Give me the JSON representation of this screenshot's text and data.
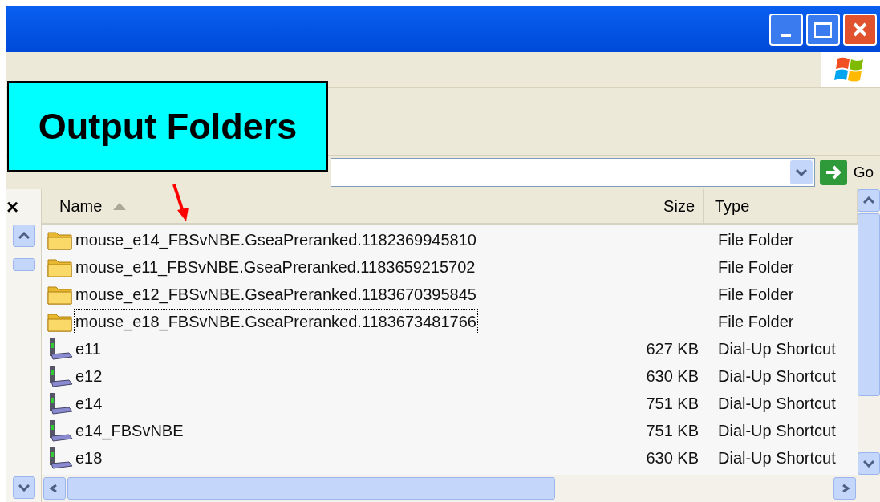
{
  "callout": {
    "text": "Output Folders"
  },
  "address_bar": {
    "go_label": "Go"
  },
  "left_pane": {
    "close_glyph": "×"
  },
  "columns": [
    {
      "label": "Name",
      "sorted": true
    },
    {
      "label": "Size",
      "sorted": false
    },
    {
      "label": "Type",
      "sorted": false
    }
  ],
  "rows": [
    {
      "kind": "folder",
      "name": "mouse_e14_FBSvNBE.GseaPreranked.1182369945810",
      "type": "File Folder",
      "focused": false
    },
    {
      "kind": "folder",
      "name": "mouse_e11_FBSvNBE.GseaPreranked.1183659215702",
      "type": "File Folder",
      "focused": false
    },
    {
      "kind": "folder",
      "name": "mouse_e12_FBSvNBE.GseaPreranked.1183670395845",
      "type": "File Folder",
      "focused": false
    },
    {
      "kind": "folder",
      "name": "mouse_e18_FBSvNBE.GseaPreranked.1183673481766",
      "type": "File Folder",
      "focused": true
    },
    {
      "kind": "dialup",
      "name": "e11",
      "size": "627 KB",
      "type": "Dial-Up Shortcut",
      "focused": false
    },
    {
      "kind": "dialup",
      "name": "e12",
      "size": "630 KB",
      "type": "Dial-Up Shortcut",
      "focused": false
    },
    {
      "kind": "dialup",
      "name": "e14",
      "size": "751 KB",
      "type": "Dial-Up Shortcut",
      "focused": false
    },
    {
      "kind": "dialup",
      "name": "e14_FBSvNBE",
      "size": "751 KB",
      "type": "Dial-Up Shortcut",
      "focused": false
    },
    {
      "kind": "dialup",
      "name": "e18",
      "size": "630 KB",
      "type": "Dial-Up Shortcut",
      "focused": false
    }
  ]
}
